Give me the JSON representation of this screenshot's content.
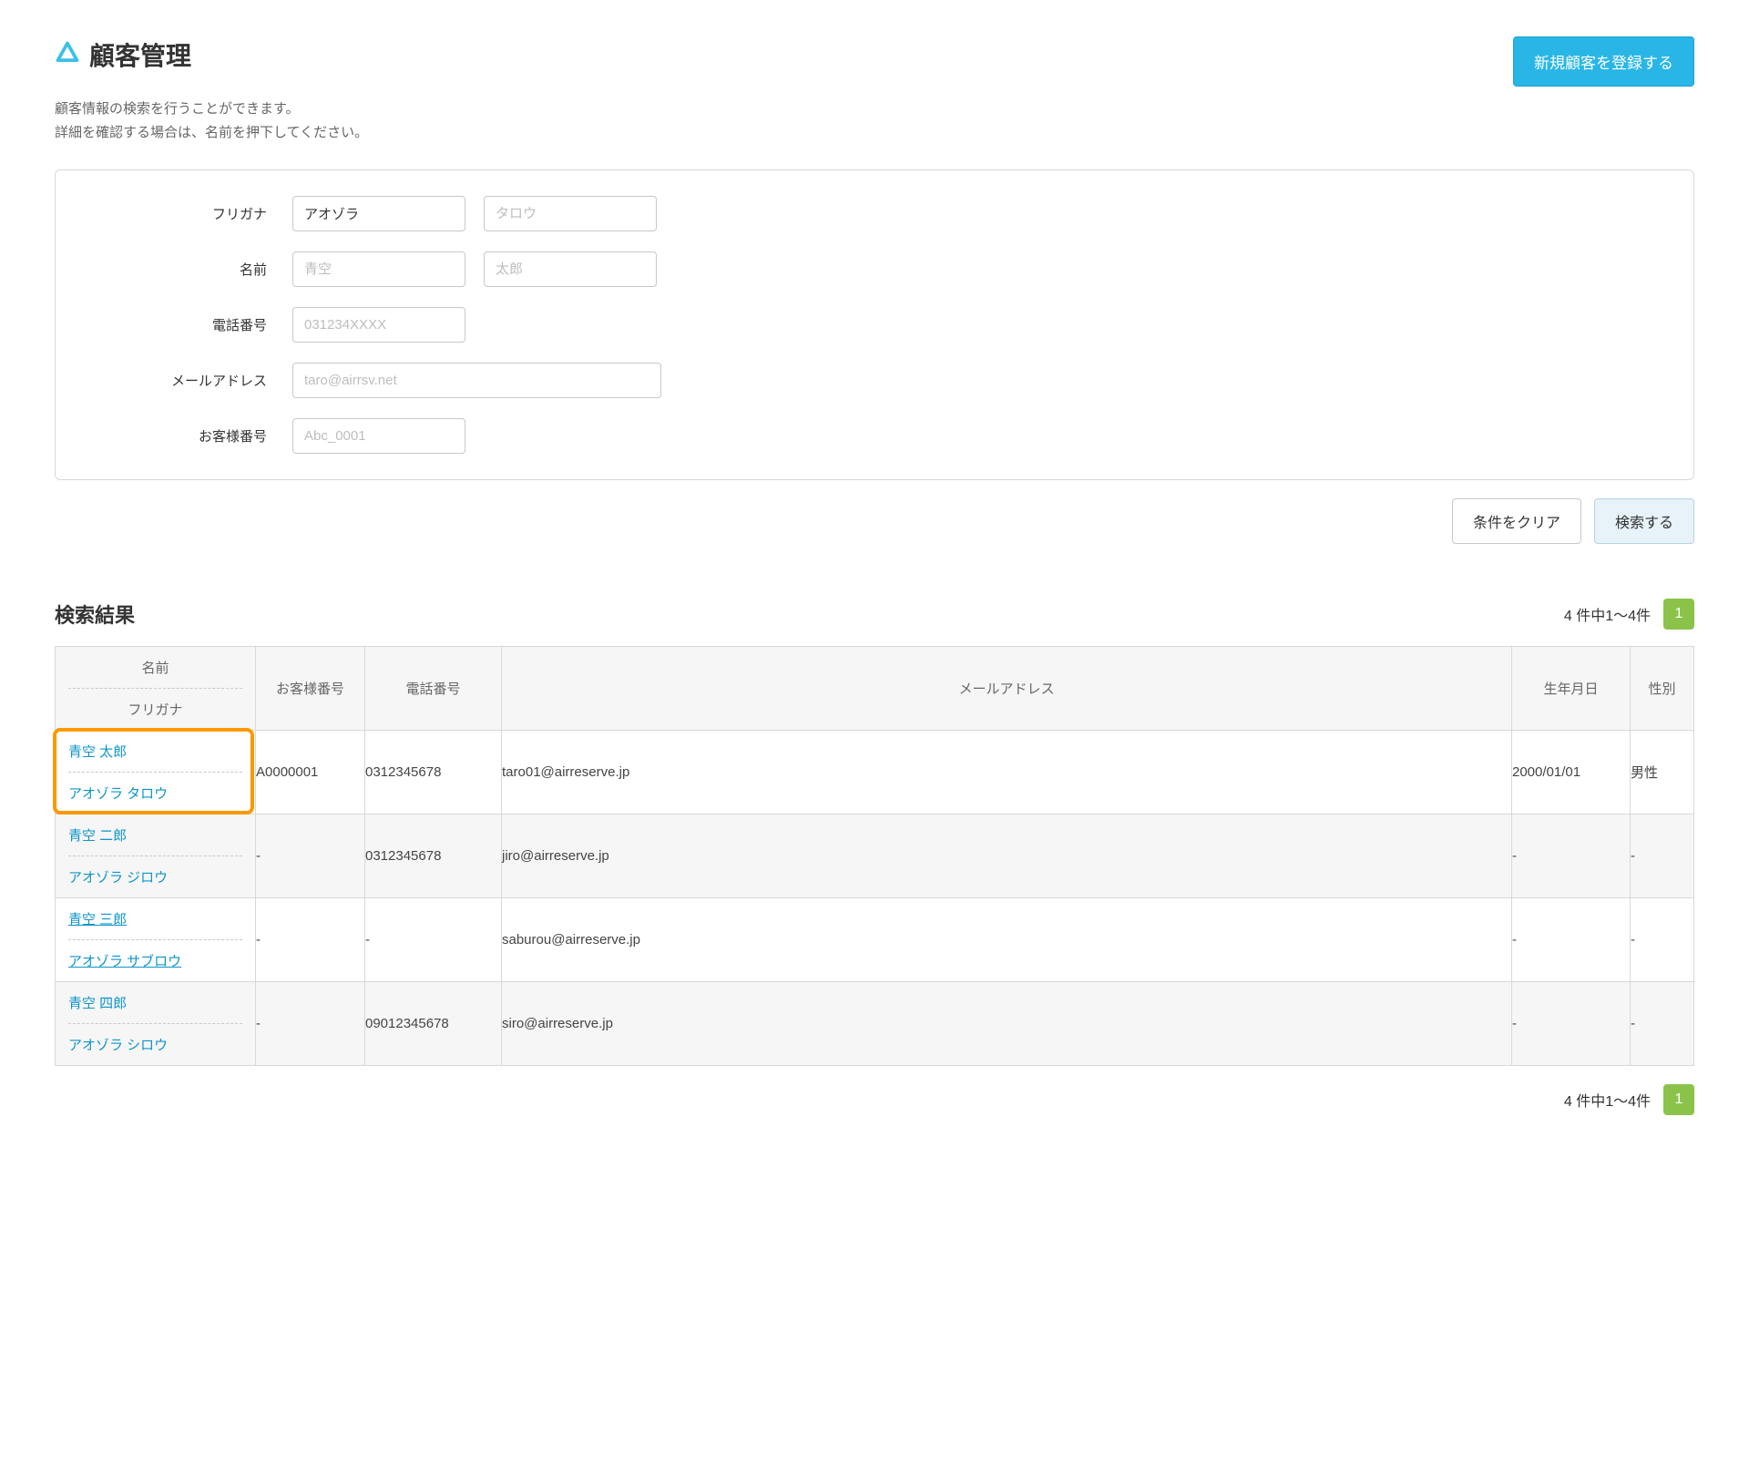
{
  "header": {
    "title": "顧客管理",
    "new_button": "新規顧客を登録する"
  },
  "description": {
    "line1": "顧客情報の検索を行うことができます。",
    "line2": "詳細を確認する場合は、名前を押下してください。"
  },
  "search_form": {
    "furigana_label": "フリガナ",
    "furigana_sei_value": "アオゾラ",
    "furigana_mei_placeholder": "タロウ",
    "name_label": "名前",
    "name_sei_placeholder": "青空",
    "name_mei_placeholder": "太郎",
    "phone_label": "電話番号",
    "phone_placeholder": "031234XXXX",
    "email_label": "メールアドレス",
    "email_placeholder": "taro@airrsv.net",
    "customer_no_label": "お客様番号",
    "customer_no_placeholder": "Abc_0001"
  },
  "actions": {
    "clear": "条件をクリア",
    "search": "検索する"
  },
  "results": {
    "title": "検索結果",
    "count_text": "4 件中1〜4件",
    "page": "1",
    "columns": {
      "name_top": "名前",
      "name_bottom": "フリガナ",
      "customer_no": "お客様番号",
      "phone": "電話番号",
      "email": "メールアドレス",
      "dob": "生年月日",
      "gender": "性別"
    },
    "rows": [
      {
        "name": "青空 太郎",
        "kana": "アオゾラ タロウ",
        "underline": false,
        "customer_no": "A0000001",
        "phone": "0312345678",
        "email": "taro01@airreserve.jp",
        "dob": "2000/01/01",
        "gender": "男性",
        "highlighted": true
      },
      {
        "name": "青空 二郎",
        "kana": "アオゾラ ジロウ",
        "underline": false,
        "customer_no": "-",
        "phone": "0312345678",
        "email": "jiro@airreserve.jp",
        "dob": "-",
        "gender": "-"
      },
      {
        "name": "青空 三郎",
        "kana": "アオゾラ サブロウ",
        "underline": true,
        "customer_no": "-",
        "phone": "-",
        "email": "saburou@airreserve.jp",
        "dob": "-",
        "gender": "-"
      },
      {
        "name": "青空 四郎",
        "kana": "アオゾラ シロウ",
        "underline": false,
        "customer_no": "-",
        "phone": "09012345678",
        "email": "siro@airreserve.jp",
        "dob": "-",
        "gender": "-"
      }
    ]
  }
}
